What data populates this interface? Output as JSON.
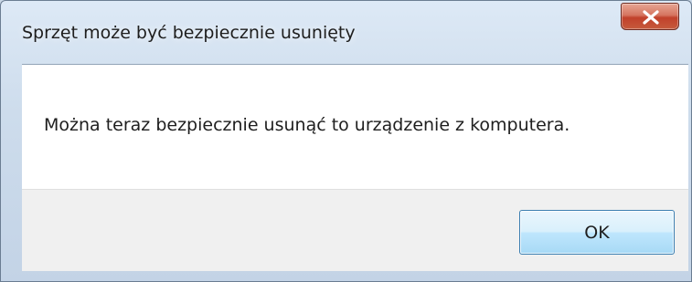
{
  "window": {
    "title": "Sprzęt może być bezpiecznie usunięty"
  },
  "dialog": {
    "message": "Można teraz bezpiecznie usunąć to urządzenie z komputera.",
    "ok_label": "OK"
  },
  "icons": {
    "close": "close-icon"
  },
  "colors": {
    "close_button": "#c9553d",
    "ok_button_border": "#3c7fb1",
    "footer_background": "#f0f0f0",
    "client_background": "#ffffff"
  }
}
